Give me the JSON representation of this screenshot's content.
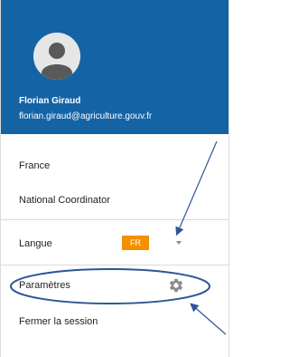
{
  "header": {
    "user_name": "Florian Giraud",
    "user_email": "florian.giraud@agriculture.gouv.fr",
    "avatar_icon": "user-avatar-icon"
  },
  "menu": {
    "country": "France",
    "role": "National Coordinator",
    "language_label": "Langue",
    "language_value": "FR",
    "settings_label": "Paramètres",
    "settings_icon": "gear-icon",
    "logout_label": "Fermer la session"
  },
  "colors": {
    "header_bg": "#1463a5",
    "language_badge": "#f29000",
    "annotation": "#2f5597"
  }
}
